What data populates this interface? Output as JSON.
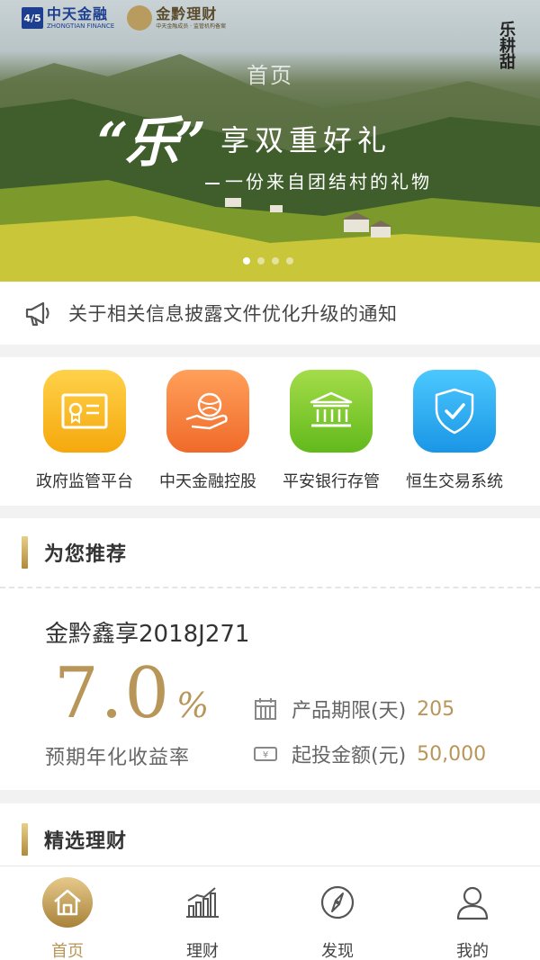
{
  "header": {
    "logo_left_mark": "4/5",
    "logo_left_cn": "中天金融",
    "logo_left_en": "ZHONGTIAN FINANCE",
    "logo_right_cn": "金黔理财",
    "logo_right_sub": "中天金融成员 · 监管机构备案",
    "page_title": "首页",
    "brand_right": "乐耕甜"
  },
  "banner": {
    "headline_mark": "“乐”",
    "headline": "享双重好礼",
    "subline": "一份来自团结村的礼物",
    "slide_count": 4,
    "active_slide": 0
  },
  "notice": {
    "icon": "megaphone-icon",
    "text": "关于相关信息披露文件优化升级的通知"
  },
  "quick": [
    {
      "label": "政府监管平台",
      "icon": "certificate-icon",
      "color": "#f7b515"
    },
    {
      "label": "中天金融控股",
      "icon": "globe-hand-icon",
      "color": "#f47a3a"
    },
    {
      "label": "平安银行存管",
      "icon": "bank-icon",
      "color": "#7fc52a"
    },
    {
      "label": "恒生交易系统",
      "icon": "shield-check-icon",
      "color": "#25a8ec"
    }
  ],
  "recommend": {
    "section_title": "为您推荐",
    "product_name": "金黔鑫享2018J271",
    "rate_value": "7.0",
    "rate_unit": "%",
    "rate_label": "预期年化收益率",
    "term_label": "产品期限(天)",
    "term_value": "205",
    "min_label": "起投金额(元)",
    "min_value": "50,000",
    "accent": "#b8965a"
  },
  "selected": {
    "section_title": "精选理财"
  },
  "tabbar": {
    "tabs": [
      {
        "label": "首页",
        "icon": "home-icon",
        "active": true
      },
      {
        "label": "理财",
        "icon": "chart-icon",
        "active": false
      },
      {
        "label": "发现",
        "icon": "compass-icon",
        "active": false
      },
      {
        "label": "我的",
        "icon": "user-icon",
        "active": false
      }
    ]
  }
}
